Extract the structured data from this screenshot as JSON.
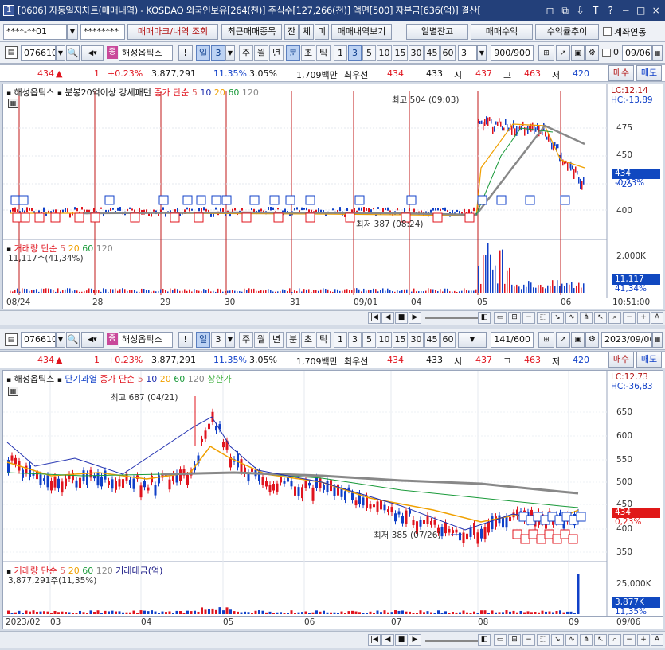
{
  "window": {
    "number": "1",
    "title": "[0606] 자동일지차트(매매내역) - KOSDAQ 외국인보유[264(천)] 주식수[127,266(천)] 액면[500] 자본금[636(억)] 결산[",
    "controls": [
      "◻",
      "⧉",
      "⇩",
      "T",
      "?",
      "−",
      "□",
      "×"
    ]
  },
  "toolbar1": {
    "account": "****-**01",
    "password": "********",
    "btn_trades": "매매마크/내역 조회",
    "btn_recent": "최근매매종목",
    "btn_jan": "잔",
    "btn_che": "체",
    "btn_mi": "미",
    "btn_view": "매매내역보기",
    "btn_daily": "일별잔고",
    "btn_profit": "매매수익",
    "btn_rate": "수익률추이",
    "chk_link": "계좌연동"
  },
  "chart1": {
    "code": "076610",
    "name": "해성옵틱스",
    "day_label": "일",
    "day_num": "3",
    "periods": [
      "주",
      "월",
      "년",
      "분",
      "초",
      "틱"
    ],
    "nums": [
      "1",
      "3",
      "5",
      "10",
      "15",
      "30",
      "45",
      "60"
    ],
    "sel_num": "3",
    "count_drop": "3",
    "count": "900/900",
    "date": "09/06",
    "zero": "0",
    "ticker": {
      "price": "434",
      "arrow": "▲",
      "chg": "1",
      "pct": "+0.23%",
      "vol": "3,877,291",
      "turn": "11.35%",
      "ratio": "3.05%",
      "amt": "1,709백만",
      "best_label": "최우선",
      "ask": "434",
      "bid": "433",
      "open_label": "시",
      "open": "437",
      "high_label": "고",
      "high": "463",
      "low_label": "저",
      "low": "420",
      "buy": "매수",
      "sell": "매도"
    },
    "legend": {
      "name": "해성옵틱스",
      "pattern": "분봉20억이상 강세패턴",
      "close": "종가 단순",
      "ma": [
        "5",
        "10",
        "20",
        "60",
        "120"
      ]
    },
    "lc": "LC:12,14",
    "hc": "HC:-13,89",
    "high_note": "최고 504 (09:03)",
    "low_note": "최저 387 (08:24)",
    "y_ticks": [
      "475",
      "450",
      "425",
      "400"
    ],
    "price_box": "434",
    "price_pct": "-0,23%",
    "vol_legend": {
      "label": "거래량",
      "simple": "단순",
      "ma": [
        "5",
        "20",
        "60",
        "120"
      ],
      "value": "11,117주(41,34%)"
    },
    "vol_axis": "2,000K",
    "vol_box": "11,117",
    "vol_pct": "41,34%",
    "x_labels": [
      "08/24",
      "28",
      "29",
      "30",
      "31",
      "09/01",
      "04",
      "05",
      "06"
    ],
    "time": "10:51:00"
  },
  "chart2": {
    "code": "076610",
    "name": "해성옵틱스",
    "day_label": "일",
    "day_num": "3",
    "periods": [
      "주",
      "월",
      "년",
      "분",
      "초",
      "틱"
    ],
    "nums": [
      "1",
      "3",
      "5",
      "10",
      "15",
      "30",
      "45",
      "60"
    ],
    "count": "141/600",
    "date": "2023/09/06",
    "ticker": {
      "price": "434",
      "arrow": "▲",
      "chg": "1",
      "pct": "+0.23%",
      "vol": "3,877,291",
      "turn": "11.35%",
      "ratio": "3.05%",
      "amt": "1,709백만",
      "best_label": "최우선",
      "ask": "434",
      "bid": "433",
      "open_label": "시",
      "open": "437",
      "high_label": "고",
      "high": "463",
      "low_label": "저",
      "low": "420",
      "buy": "매수",
      "sell": "매도"
    },
    "legend": {
      "name": "해성옵틱스",
      "overheat": "단기과열",
      "close": "종가 단순",
      "ma": [
        "5",
        "10",
        "20",
        "60",
        "120"
      ],
      "limit": "상한가"
    },
    "lc": "LC:12,73",
    "hc": "HC:-36,83",
    "high_note": "최고 687 (04/21)",
    "low_note": "최저 385 (07/26)",
    "y_ticks": [
      "650",
      "600",
      "550",
      "500",
      "450",
      "400",
      "350"
    ],
    "price_box": "434",
    "price_pct": "0,23%",
    "vol_legend": {
      "label": "거래량",
      "simple": "단순",
      "ma": [
        "5",
        "20",
        "60",
        "120"
      ],
      "amt": "거래대금(억)",
      "value": "3,877,291주(11,35%)"
    },
    "vol_axis": "25,000K",
    "vol_box": "3,877K",
    "vol_pct": "11,35%",
    "x_labels": [
      "2023/02",
      "03",
      "04",
      "05",
      "06",
      "07",
      "08",
      "09"
    ],
    "date_end": "09/06"
  },
  "colors": {
    "up": "#e0141e",
    "down": "#1040c8",
    "ma5": "#e06666",
    "ma10": "#2030b0",
    "ma20": "#f0a000",
    "ma60": "#1a9a3a",
    "ma120": "#888888"
  }
}
